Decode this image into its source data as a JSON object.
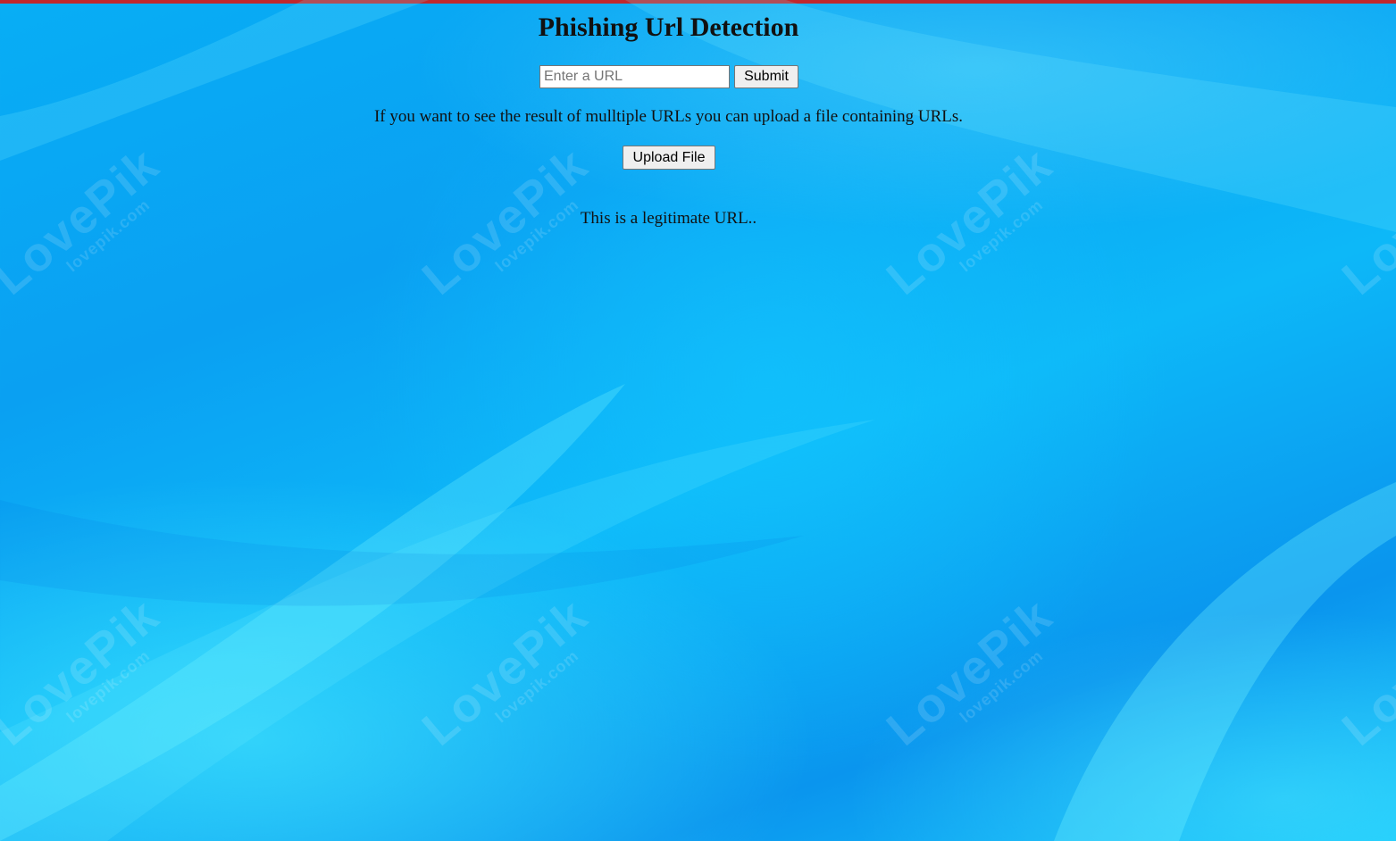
{
  "page": {
    "title": "Phishing Url Detection",
    "accent_top_strip": "#c1272d",
    "background_color": "#0aa6f3"
  },
  "url_form": {
    "placeholder": "Enter a URL",
    "value": "",
    "submit_label": "Submit"
  },
  "bulk": {
    "info_text": "If you want to see the result of mulltiple URLs you can upload a file containing URLs.",
    "upload_label": "Upload File"
  },
  "result": {
    "message": "This is a legitimate URL.."
  },
  "watermark": {
    "brand": "LovePik",
    "domain": "lovepik.com"
  }
}
